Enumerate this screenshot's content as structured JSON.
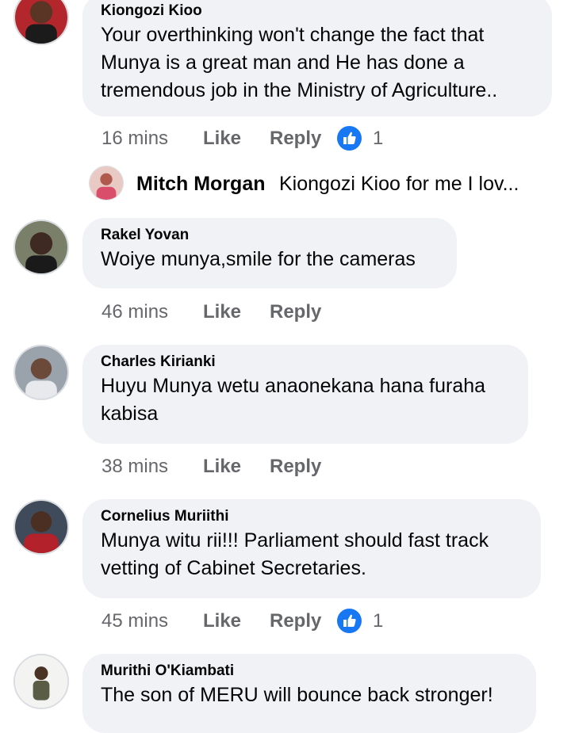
{
  "colors": {
    "bubble": "#f0f2f5",
    "meta": "#65676b",
    "like_badge": "#1877f2"
  },
  "comments": [
    {
      "author": "Kiongozi Kioo",
      "lines": [
        "Your overthinking won't change the fact that",
        "Munya is a great man and He has done a",
        "tremendous job in the Ministry of Agriculture.."
      ],
      "time": "16 mins",
      "like": "Like",
      "reply": "Reply",
      "reaction_count": "1",
      "reaction_icon": "thumbs-up-icon"
    },
    {
      "author": "Rakel Yovan",
      "lines": [
        "Woiye munya,smile for the cameras"
      ],
      "time": "46 mins",
      "like": "Like",
      "reply": "Reply"
    },
    {
      "author": "Charles Kirianki",
      "lines": [
        "Huyu Munya wetu anaonekana hana furaha",
        "kabisa"
      ],
      "time": "38 mins",
      "like": "Like",
      "reply": "Reply"
    },
    {
      "author": "Cornelius Muriithi",
      "lines": [
        "Munya witu rii!!! Parliament should fast track",
        "vetting of Cabinet Secretaries."
      ],
      "time": "45 mins",
      "like": "Like",
      "reply": "Reply",
      "reaction_count": "1",
      "reaction_icon": "thumbs-up-icon"
    },
    {
      "author": "Murithi O'Kiambati",
      "lines": [
        "The son of MERU will bounce back stronger!"
      ]
    }
  ],
  "reply_preview": {
    "author": "Mitch Morgan",
    "text": "Kiongozi Kioo for me I lov..."
  }
}
